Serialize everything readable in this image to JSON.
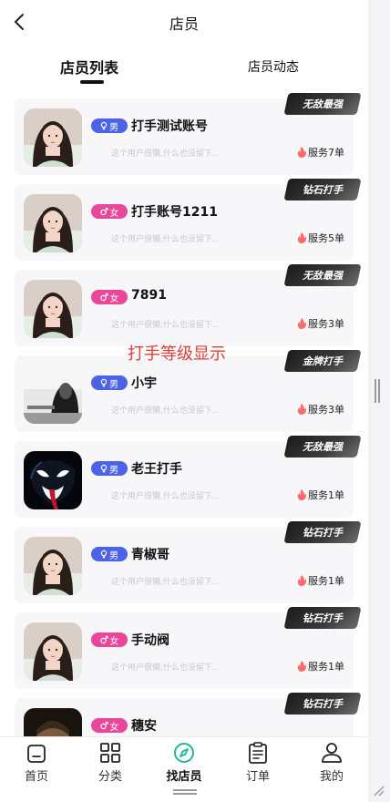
{
  "header": {
    "title": "店员",
    "back_icon": "chevron-left-icon"
  },
  "tabs": [
    {
      "label": "店员列表",
      "active": true
    },
    {
      "label": "店员动态",
      "active": false
    }
  ],
  "annotation": "打手等级显示",
  "staff": [
    {
      "name": "打手测试账号",
      "gender_label": "男",
      "gender": "male",
      "bio": "这个用户很懒,什么也没留下...",
      "served": "服务7单",
      "rank": "无敌最强",
      "avatar": "girl-photo"
    },
    {
      "name": "打手账号1211",
      "gender_label": "女",
      "gender": "female",
      "bio": "这个用户很懒,什么也没留下...",
      "served": "服务5单",
      "rank": "钻石打手",
      "avatar": "girl-photo"
    },
    {
      "name": "7891",
      "gender_label": "女",
      "gender": "female",
      "bio": "这个用户很懒,什么也没留下...",
      "served": "服务3单",
      "rank": "无敌最强",
      "avatar": "girl-photo"
    },
    {
      "name": "小宇",
      "gender_label": "男",
      "gender": "male",
      "bio": "这个用户很懒,什么也没留下...",
      "served": "服务3单",
      "rank": "金牌打手",
      "avatar": "bw-photo"
    },
    {
      "name": "老王打手",
      "gender_label": "男",
      "gender": "male",
      "bio": "这个用户很懒,什么也没留下...",
      "served": "服务1单",
      "rank": "无敌最强",
      "avatar": "venom-photo"
    },
    {
      "name": "青椒哥",
      "gender_label": "男",
      "gender": "male",
      "bio": "这个用户很懒,什么也没留下...",
      "served": "服务1单",
      "rank": "钻石打手",
      "avatar": "girl-photo"
    },
    {
      "name": "手动阀",
      "gender_label": "女",
      "gender": "female",
      "bio": "这个用户很懒,什么也没留下...",
      "served": "服务1单",
      "rank": "钻石打手",
      "avatar": "girl-photo"
    },
    {
      "name": "穗安",
      "gender_label": "女",
      "gender": "female",
      "bio": "",
      "served": "",
      "rank": "钻石打手",
      "avatar": "dark-photo"
    }
  ],
  "tabbar": [
    {
      "label": "首页",
      "icon": "home-icon",
      "active": false
    },
    {
      "label": "分类",
      "icon": "grid-icon",
      "active": false
    },
    {
      "label": "找店员",
      "icon": "compass-icon",
      "active": true
    },
    {
      "label": "订单",
      "icon": "clipboard-icon",
      "active": false
    },
    {
      "label": "我的",
      "icon": "user-icon",
      "active": false
    }
  ],
  "colors": {
    "male": "#4c63e6",
    "female": "#e8479a",
    "fire": "#ff6b6b",
    "accent": "#1fb89a",
    "annotation": "#e23b3b"
  }
}
